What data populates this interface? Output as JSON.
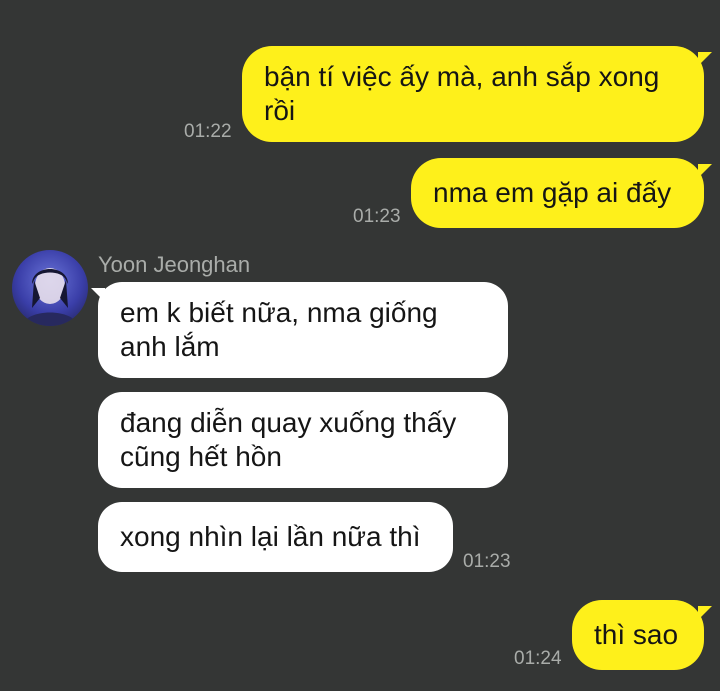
{
  "chat": {
    "messages": [
      {
        "id": "m1",
        "side": "mine",
        "text": "bận tí việc ấy mà, anh sắp xong rồi",
        "time": "01:22"
      },
      {
        "id": "m2",
        "side": "mine",
        "text": "nma em gặp ai đấy",
        "time": "01:23"
      },
      {
        "id": "m3",
        "side": "theirs",
        "text": "em k biết nữa, nma giống anh lắm"
      },
      {
        "id": "m4",
        "side": "theirs",
        "text": "đang diễn quay xuống thấy cũng hết hồn"
      },
      {
        "id": "m5",
        "side": "theirs",
        "text": "xong nhìn lại lần nữa thì",
        "time": "01:23"
      },
      {
        "id": "m6",
        "side": "mine",
        "text": "thì sao",
        "time": "01:24"
      }
    ],
    "sender": {
      "name": "Yoon Jeonghan",
      "avatar": "profile-photo"
    }
  },
  "colors": {
    "background": "#343635",
    "my_bubble": "#fef01b",
    "their_bubble": "#ffffff",
    "timestamp": "#a9aca9",
    "text": "#151515"
  }
}
